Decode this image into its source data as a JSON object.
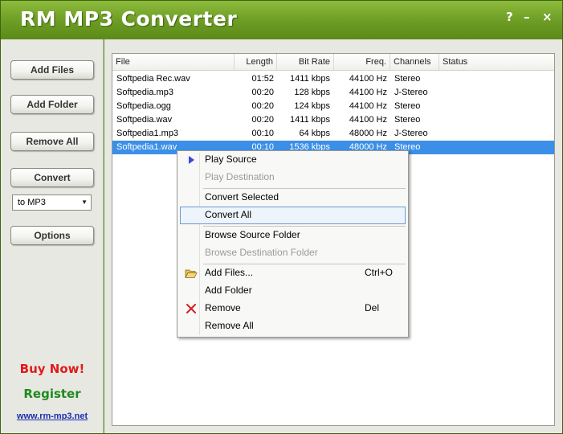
{
  "window": {
    "title": "RM MP3 Converter",
    "controls": {
      "help": "?",
      "minimize": "–",
      "close": "×"
    }
  },
  "sidebar": {
    "add_files": "Add Files",
    "add_folder": "Add Folder",
    "remove_all": "Remove All",
    "convert": "Convert",
    "format_value": "to MP3",
    "options": "Options",
    "buy_now": "Buy Now!",
    "register": "Register",
    "website": "www.rm-mp3.net"
  },
  "table": {
    "columns": [
      "File",
      "Length",
      "Bit Rate",
      "Freq.",
      "Channels",
      "Status"
    ],
    "rows": [
      {
        "file": "Softpedia Rec.wav",
        "length": "01:52",
        "bitrate": "1411 kbps",
        "freq": "44100 Hz",
        "channels": "Stereo",
        "status": ""
      },
      {
        "file": "Softpedia.mp3",
        "length": "00:20",
        "bitrate": "128 kbps",
        "freq": "44100 Hz",
        "channels": "J-Stereo",
        "status": ""
      },
      {
        "file": "Softpedia.ogg",
        "length": "00:20",
        "bitrate": "124 kbps",
        "freq": "44100 Hz",
        "channels": "Stereo",
        "status": ""
      },
      {
        "file": "Softpedia.wav",
        "length": "00:20",
        "bitrate": "1411 kbps",
        "freq": "44100 Hz",
        "channels": "Stereo",
        "status": ""
      },
      {
        "file": "Softpedia1.mp3",
        "length": "00:10",
        "bitrate": "64 kbps",
        "freq": "48000 Hz",
        "channels": "J-Stereo",
        "status": ""
      },
      {
        "file": "Softpedia1.wav",
        "length": "00:10",
        "bitrate": "1536 kbps",
        "freq": "48000 Hz",
        "channels": "Stereo",
        "status": ""
      }
    ],
    "selected_index": 5
  },
  "context_menu": {
    "play_source": "Play Source",
    "play_destination": "Play Destination",
    "convert_selected": "Convert Selected",
    "convert_all": "Convert All",
    "browse_source": "Browse Source Folder",
    "browse_destination": "Browse Destination Folder",
    "add_files": "Add Files...",
    "add_files_shortcut": "Ctrl+O",
    "add_folder": "Add Folder",
    "remove": "Remove",
    "remove_shortcut": "Del",
    "remove_all": "Remove All"
  },
  "colors": {
    "title_bar": "#6e9e26",
    "selection": "#3b8fe6",
    "buy_now": "#e21a1a",
    "register": "#1f8a1f",
    "link": "#1a2fb0"
  }
}
